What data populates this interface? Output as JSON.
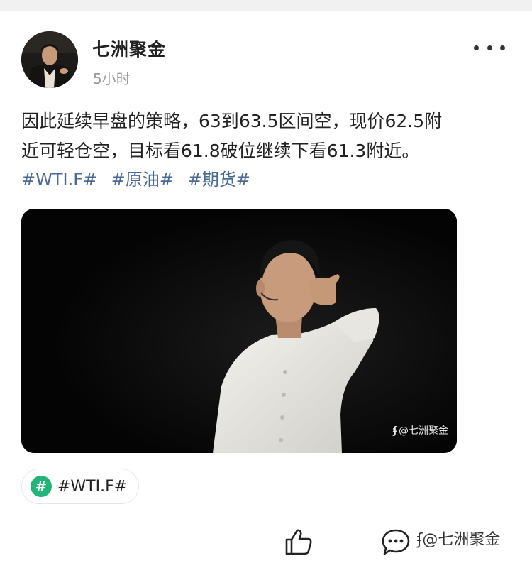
{
  "post": {
    "author": {
      "name": "七洲聚金",
      "time": "5小时"
    },
    "text_lines": [
      "因此延续早盘的策略，63到63.5区间空，现价62.5附",
      "近可轻仓空，目标看61.8破位继续下看61.3附近。"
    ],
    "hashtags": [
      "#WTI.F#",
      "#原油#",
      "#期货#"
    ],
    "image": {
      "watermark": "@七洲聚金",
      "watermark_logo": "ʄ"
    },
    "topic_chip": {
      "icon": "#",
      "label": "#WTI.F#"
    },
    "actions": {
      "like_icon": "thumbs-up-icon",
      "comment_icon": "comment-icon",
      "more_icon": "more-dots-icon"
    }
  },
  "footer": {
    "watermark_logo": "ʄ",
    "watermark": "@七洲聚金"
  },
  "colors": {
    "tag_blue": "#4a6a92",
    "chip_green": "#23b477",
    "time_gray": "#9a9a9a",
    "text": "#222222"
  }
}
